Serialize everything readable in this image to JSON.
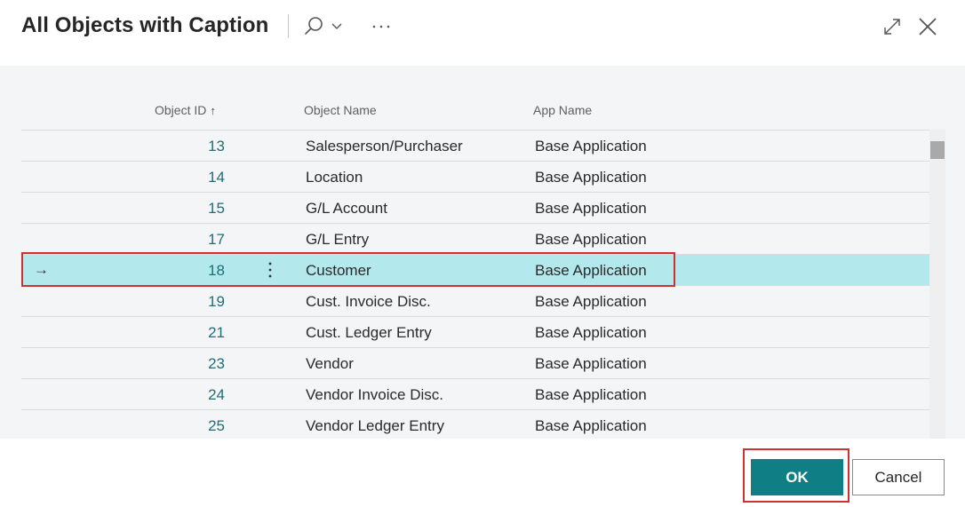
{
  "dialog": {
    "title": "All Objects with Caption"
  },
  "toolbar": {
    "search_icon": "search-icon",
    "more_icon": "more-options-icon",
    "expand_icon": "expand-icon",
    "close_icon": "close-icon"
  },
  "columns": {
    "object_id": "Object ID",
    "object_name": "Object Name",
    "app_name": "App Name",
    "sort": "ascending"
  },
  "rows": [
    {
      "id": "13",
      "name": "Salesperson/Purchaser",
      "app": "Base Application"
    },
    {
      "id": "14",
      "name": "Location",
      "app": "Base Application"
    },
    {
      "id": "15",
      "name": "G/L Account",
      "app": "Base Application"
    },
    {
      "id": "17",
      "name": "G/L Entry",
      "app": "Base Application"
    },
    {
      "id": "18",
      "name": "Customer",
      "app": "Base Application",
      "selected": true
    },
    {
      "id": "19",
      "name": "Cust. Invoice Disc.",
      "app": "Base Application"
    },
    {
      "id": "21",
      "name": "Cust. Ledger Entry",
      "app": "Base Application"
    },
    {
      "id": "23",
      "name": "Vendor",
      "app": "Base Application"
    },
    {
      "id": "24",
      "name": "Vendor Invoice Disc.",
      "app": "Base Application"
    },
    {
      "id": "25",
      "name": "Vendor Ledger Entry",
      "app": "Base Application"
    }
  ],
  "footer": {
    "ok_label": "OK",
    "cancel_label": "Cancel"
  },
  "colors": {
    "accent": "#0f7e85",
    "selected_row": "#b3e8ec",
    "highlight": "#d0302f",
    "id_text": "#1c6f75"
  }
}
